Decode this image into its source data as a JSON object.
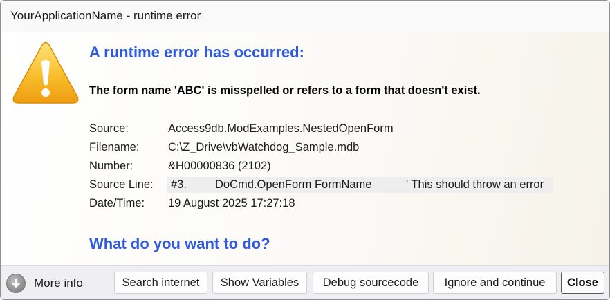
{
  "window": {
    "title": "YourApplicationName - runtime error"
  },
  "icon": {
    "name": "warning-icon",
    "color": "#f6b21e"
  },
  "heading": "A runtime error has occurred:",
  "message": "The form name 'ABC' is misspelled or refers to a form that doesn't exist.",
  "details": {
    "source_label": "Source:",
    "source_value": "Access9db.ModExamples.NestedOpenForm",
    "filename_label": "Filename:",
    "filename_value": "C:\\Z_Drive\\vbWatchdog_Sample.mdb",
    "number_label": "Number:",
    "number_value": "&H00000836 (2102)",
    "source_line_label": "Source Line:",
    "source_line_number": "#3.",
    "source_line_statement": "DoCmd.OpenForm FormName",
    "source_line_comment": "' This should throw an error",
    "datetime_label": "Date/Time:",
    "datetime_value": "19 August 2025  17:27:18"
  },
  "question": "What do you want to do?",
  "footer": {
    "more_info_label": "More info",
    "more_info_icon": "chevron-down-circle-icon",
    "buttons": {
      "search_internet": "Search internet",
      "show_variables": "Show Variables",
      "debug_sourcecode": "Debug sourcecode",
      "ignore_and_continue": "Ignore and continue",
      "close": "Close"
    }
  },
  "colors": {
    "accent": "#2f5ae0",
    "footer_bg": "#eeeef3",
    "code_bg": "#eeeeee"
  }
}
